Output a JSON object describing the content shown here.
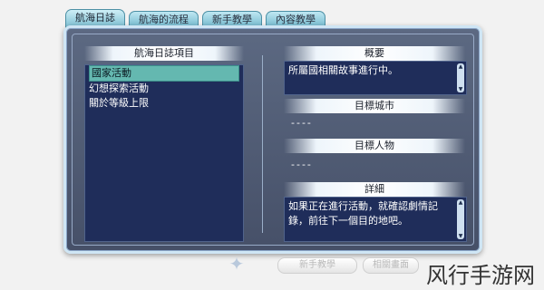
{
  "tabs": [
    {
      "label": "航海日誌",
      "active": true
    },
    {
      "label": "航海的流程",
      "active": false
    },
    {
      "label": "新手教學",
      "active": false
    },
    {
      "label": "內容教學",
      "active": false
    }
  ],
  "left": {
    "header": "航海日誌項目",
    "items": [
      "國家活動",
      "幻想探索活動",
      "關於等級上限"
    ],
    "selected_index": 0
  },
  "right": {
    "overview": {
      "header": "概要",
      "text": "所屬國相關故事進行中。"
    },
    "target_city": {
      "header": "目標城市",
      "value": "----"
    },
    "target_person": {
      "header": "目標人物",
      "value": "----"
    },
    "details": {
      "header": "詳細",
      "text": "如果正在進行活動，就確認劇情記錄，前往下一個目的地吧。"
    }
  },
  "bottom": {
    "tutorial_button": "新手教學",
    "related_button": "相關畫面"
  },
  "watermark": "风行手游网",
  "icons": {
    "scroll_up": "triangle-up",
    "scroll_down": "triangle-down",
    "ornament": "emblem"
  },
  "colors": {
    "window_bg": "#4f5b76",
    "list_bg": "#1f2d5a",
    "selected": "#64b8b0",
    "tab": "#8cc8da"
  }
}
